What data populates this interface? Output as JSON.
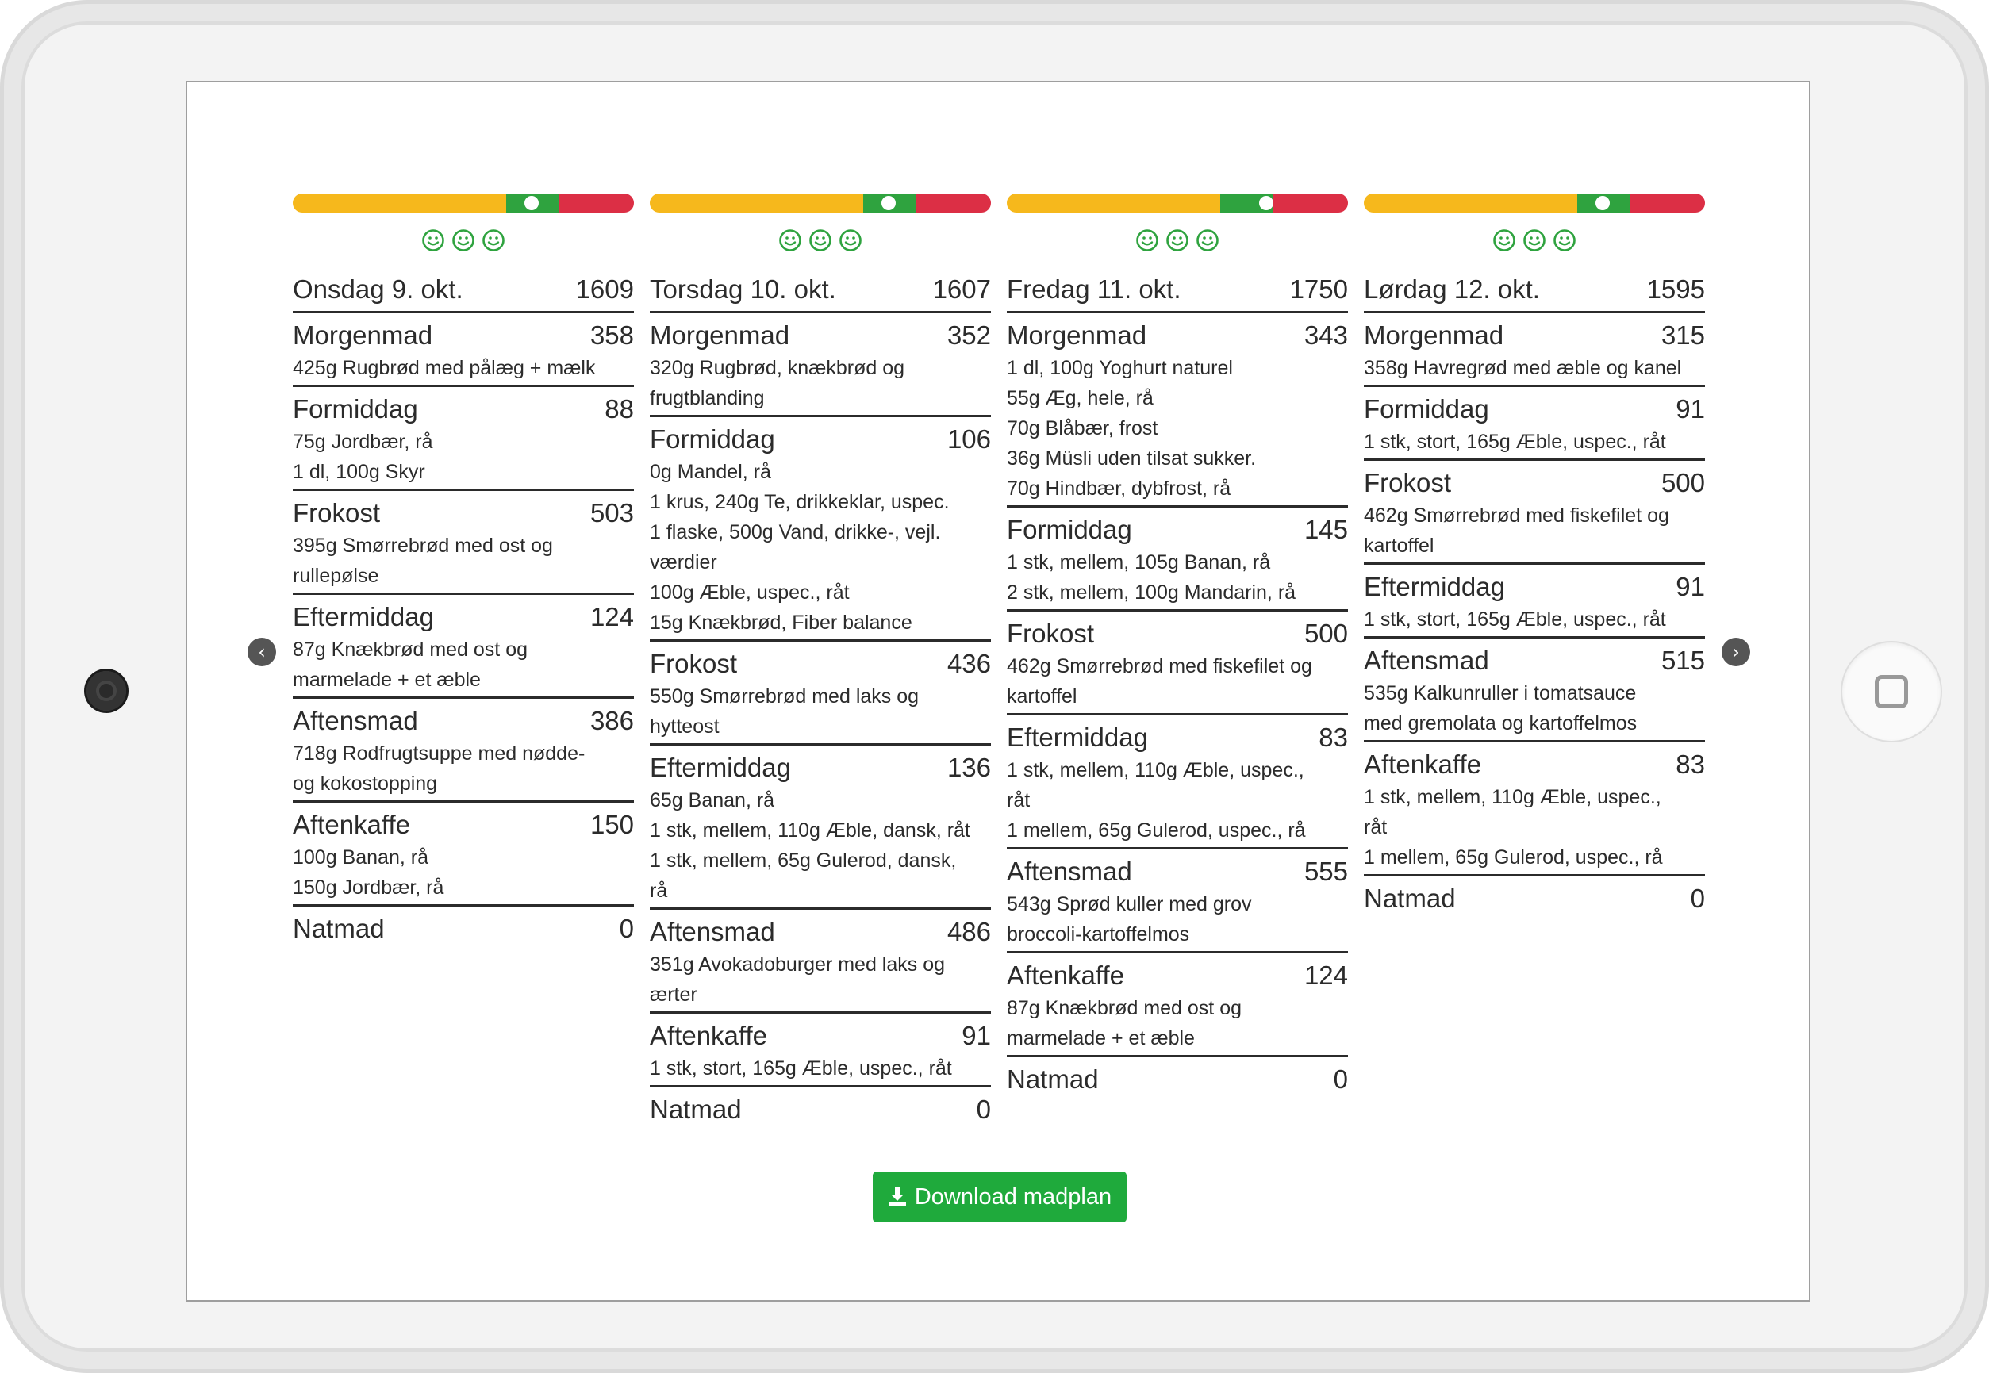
{
  "actions": {
    "download_label": "Download madplan"
  },
  "colors": {
    "yellow": "#f6b81c",
    "green": "#2fa33f",
    "red": "#dc2f45",
    "smiley": "#2fa33f",
    "button": "#1faa3c"
  },
  "days": [
    {
      "title": "Onsdag 9. okt.",
      "total": "1609",
      "gauge_fraction": 0.7,
      "meals": [
        {
          "name": "Morgenmad",
          "kcal": "358",
          "items": [
            "425g Rugbrød med pålæg + mælk"
          ]
        },
        {
          "name": "Formiddag",
          "kcal": "88",
          "items": [
            "75g Jordbær, rå",
            "1 dl, 100g Skyr"
          ]
        },
        {
          "name": "Frokost",
          "kcal": "503",
          "items": [
            "395g Smørrebrød med ost og",
            "rullepølse"
          ]
        },
        {
          "name": "Eftermiddag",
          "kcal": "124",
          "items": [
            "87g Knækbrød med ost og",
            "marmelade + et æble"
          ]
        },
        {
          "name": "Aftensmad",
          "kcal": "386",
          "items": [
            "718g Rodfrugtsuppe med nødde-",
            "og kokostopping"
          ]
        },
        {
          "name": "Aftenkaffe",
          "kcal": "150",
          "items": [
            "100g Banan, rå",
            "150g Jordbær, rå"
          ]
        },
        {
          "name": "Natmad",
          "kcal": "0",
          "items": []
        }
      ]
    },
    {
      "title": "Torsdag 10. okt.",
      "total": "1607",
      "gauge_fraction": 0.7,
      "meals": [
        {
          "name": "Morgenmad",
          "kcal": "352",
          "items": [
            "320g Rugbrød, knækbrød og",
            "frugtblanding"
          ]
        },
        {
          "name": "Formiddag",
          "kcal": "106",
          "items": [
            "0g Mandel, rå",
            "1 krus, 240g Te, drikkeklar, uspec.",
            "1 flaske, 500g Vand, drikke-, vejl.",
            "værdier",
            "100g Æble, uspec., råt",
            "15g Knækbrød, Fiber balance"
          ]
        },
        {
          "name": "Frokost",
          "kcal": "436",
          "items": [
            "550g Smørrebrød med laks og",
            "hytteost"
          ]
        },
        {
          "name": "Eftermiddag",
          "kcal": "136",
          "items": [
            "65g Banan, rå",
            "1 stk, mellem, 110g Æble, dansk, råt",
            "1 stk, mellem, 65g Gulerod, dansk,",
            "rå"
          ]
        },
        {
          "name": "Aftensmad",
          "kcal": "486",
          "items": [
            "351g Avokadoburger med laks og",
            "ærter"
          ]
        },
        {
          "name": "Aftenkaffe",
          "kcal": "91",
          "items": [
            "1 stk, stort, 165g Æble, uspec., råt"
          ]
        },
        {
          "name": "Natmad",
          "kcal": "0",
          "items": []
        }
      ]
    },
    {
      "title": "Fredag 11. okt.",
      "total": "1750",
      "gauge_fraction": 0.76,
      "meals": [
        {
          "name": "Morgenmad",
          "kcal": "343",
          "items": [
            "1 dl, 100g Yoghurt naturel",
            "55g Æg, hele, rå",
            "70g Blåbær, frost",
            "36g Müsli uden tilsat sukker.",
            "70g Hindbær, dybfrost, rå"
          ]
        },
        {
          "name": "Formiddag",
          "kcal": "145",
          "items": [
            "1 stk, mellem, 105g Banan, rå",
            "2 stk, mellem, 100g Mandarin, rå"
          ]
        },
        {
          "name": "Frokost",
          "kcal": "500",
          "items": [
            "462g Smørrebrød med fiskefilet og",
            "kartoffel"
          ]
        },
        {
          "name": "Eftermiddag",
          "kcal": "83",
          "items": [
            "1 stk, mellem, 110g Æble, uspec.,",
            "råt",
            "1 mellem, 65g Gulerod, uspec., rå"
          ]
        },
        {
          "name": "Aftensmad",
          "kcal": "555",
          "items": [
            "543g Sprød kuller med grov",
            "broccoli-kartoffelmos"
          ]
        },
        {
          "name": "Aftenkaffe",
          "kcal": "124",
          "items": [
            "87g Knækbrød med ost og",
            "marmelade + et æble"
          ]
        },
        {
          "name": "Natmad",
          "kcal": "0",
          "items": []
        }
      ]
    },
    {
      "title": "Lørdag 12. okt.",
      "total": "1595",
      "gauge_fraction": 0.7,
      "meals": [
        {
          "name": "Morgenmad",
          "kcal": "315",
          "items": [
            "358g Havregrød med æble og kanel"
          ]
        },
        {
          "name": "Formiddag",
          "kcal": "91",
          "items": [
            "1 stk, stort, 165g Æble, uspec., råt"
          ]
        },
        {
          "name": "Frokost",
          "kcal": "500",
          "items": [
            "462g Smørrebrød med fiskefilet og",
            "kartoffel"
          ]
        },
        {
          "name": "Eftermiddag",
          "kcal": "91",
          "items": [
            "1 stk, stort, 165g Æble, uspec., råt"
          ]
        },
        {
          "name": "Aftensmad",
          "kcal": "515",
          "items": [
            "535g Kalkunruller i tomatsauce",
            "med gremolata og kartoffelmos"
          ]
        },
        {
          "name": "Aftenkaffe",
          "kcal": "83",
          "items": [
            "1 stk, mellem, 110g Æble, uspec.,",
            "råt",
            "1 mellem, 65g Gulerod, uspec., rå"
          ]
        },
        {
          "name": "Natmad",
          "kcal": "0",
          "items": []
        }
      ]
    }
  ]
}
